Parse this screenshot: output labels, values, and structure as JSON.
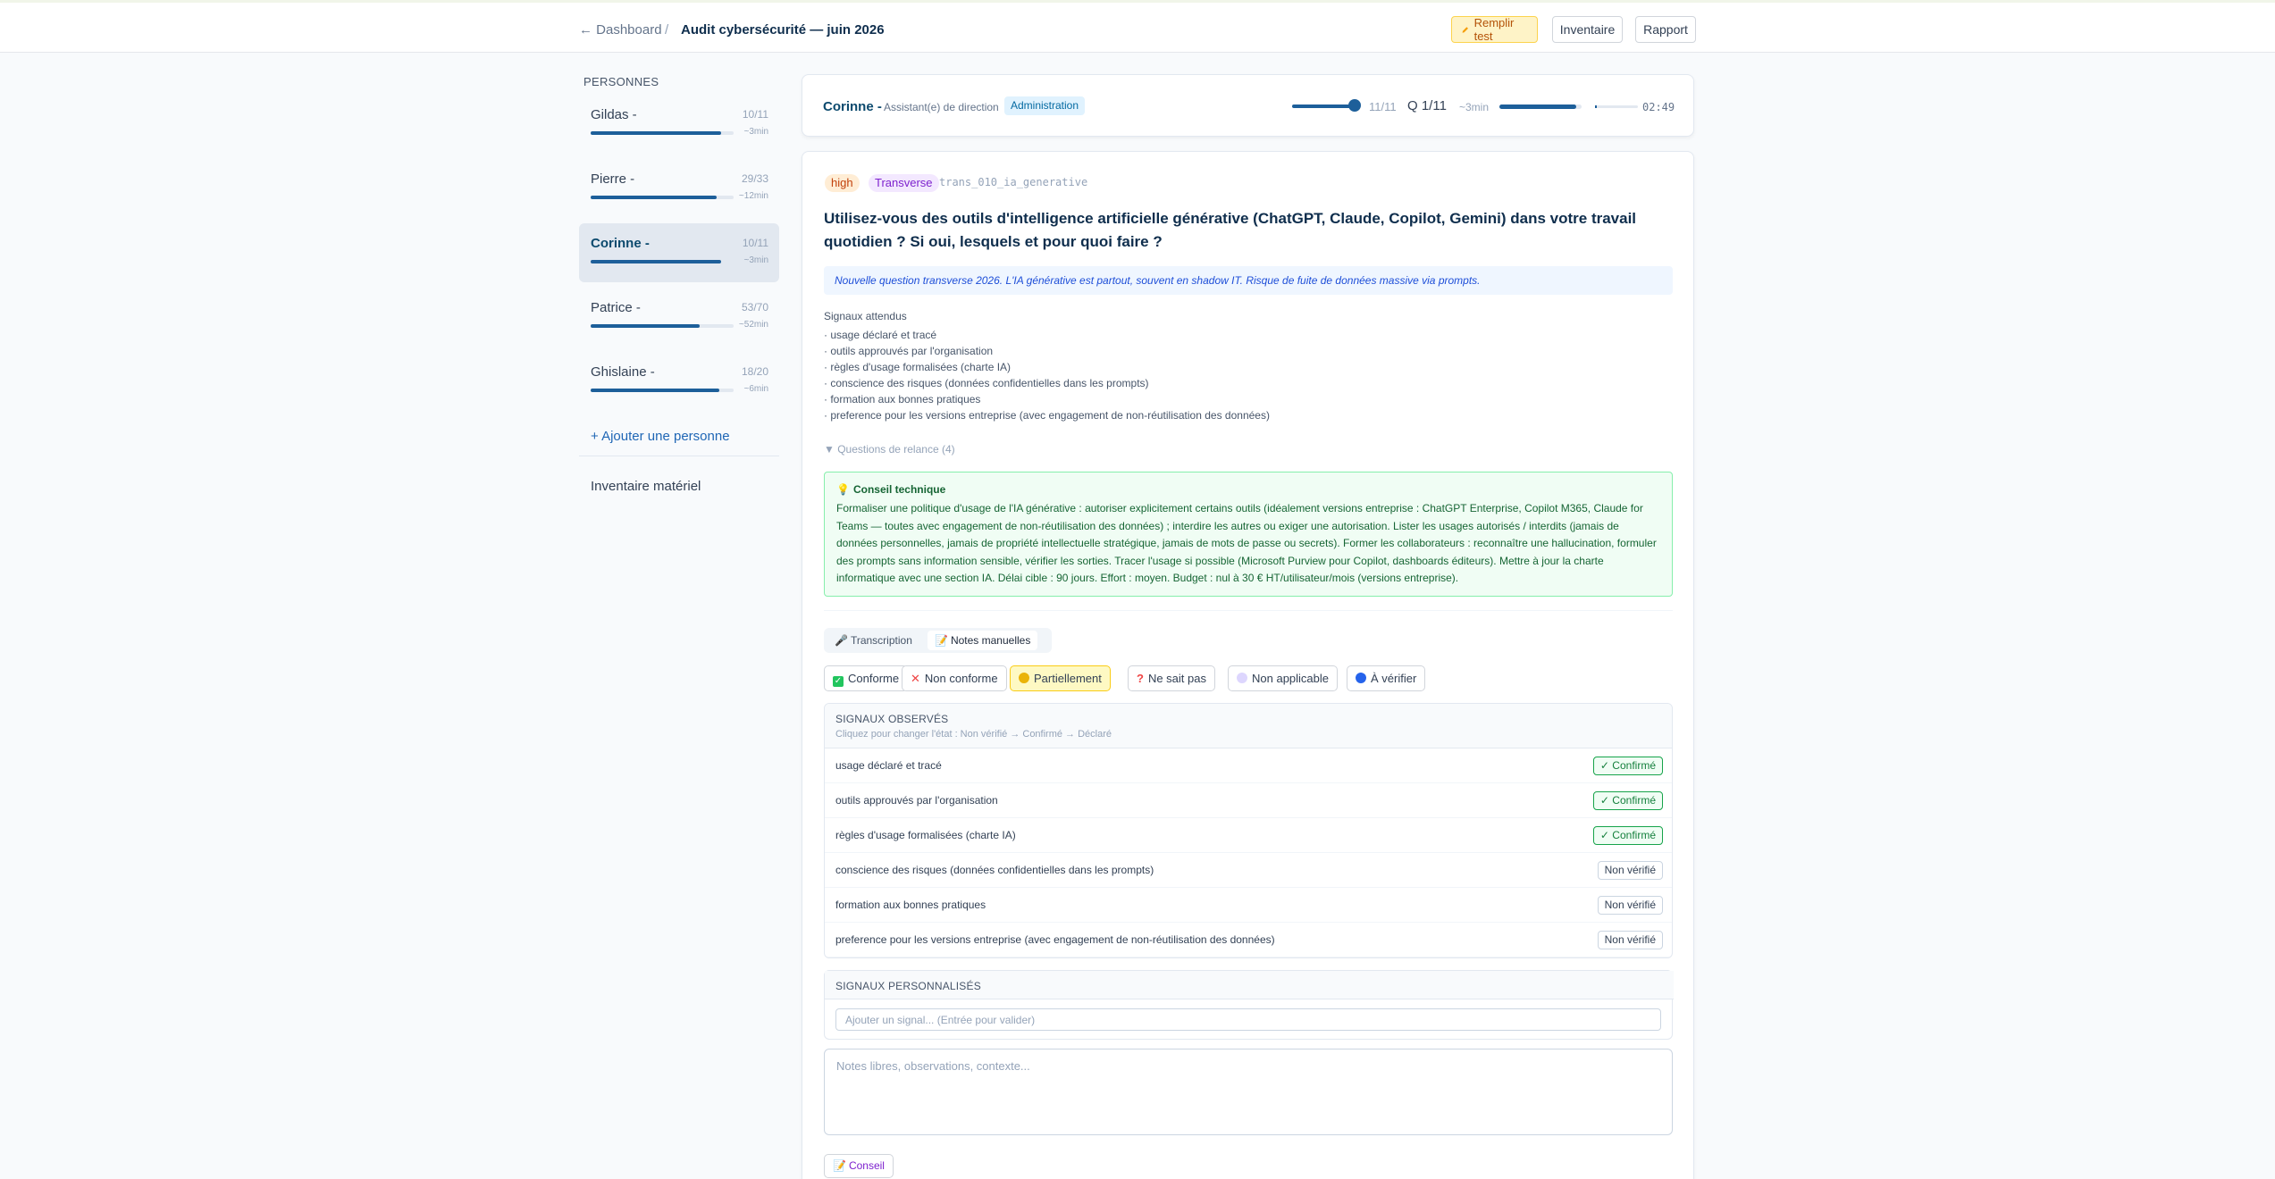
{
  "topbar": {
    "back_label": "← Dashboard",
    "separator": "/",
    "title": "Audit cybersécurité — juin 2026",
    "fill_test_label": "Remplir test",
    "fill_test_icon": "pencil-icon",
    "inventory_label": "Inventaire",
    "report_label": "Rapport"
  },
  "sidebar": {
    "heading": "PERSONNES",
    "people": [
      {
        "name": "Gildas -",
        "count": "10/11",
        "time": "~3min",
        "progress": 0.91,
        "active": false
      },
      {
        "name": "Pierre -",
        "count": "29/33",
        "time": "~12min",
        "progress": 0.88,
        "active": false
      },
      {
        "name": "Corinne -",
        "count": "10/11",
        "time": "~3min",
        "progress": 0.91,
        "active": true
      },
      {
        "name": "Patrice -",
        "count": "53/70",
        "time": "~52min",
        "progress": 0.76,
        "active": false
      },
      {
        "name": "Ghislaine -",
        "count": "18/20",
        "time": "~6min",
        "progress": 0.9,
        "active": false
      }
    ],
    "add_person": "+ Ajouter une personne",
    "inventory_link": "Inventaire matériel"
  },
  "header": {
    "name": "Corinne -",
    "role": "Assistant(e) de direction",
    "department": "Administration",
    "progress": "11/11",
    "question": "Q 1/11",
    "time_estimate": "~3min",
    "timer": "02:49",
    "slider_level": 1.0,
    "progress_bar": 0.93
  },
  "question": {
    "priority": "high",
    "category": "Transverse",
    "id": "trans_010_ia_generative",
    "text": "Utilisez-vous des outils d'intelligence artificielle générative (ChatGPT, Claude, Copilot, Gemini) dans votre travail quotidien ? Si oui, lesquels et pour quoi faire ?",
    "note": "Nouvelle question transverse 2026. L'IA générative est partout, souvent en shadow IT. Risque de fuite de données massive via prompts.",
    "signals_title": "Signaux attendus",
    "signals": [
      "· usage déclaré et tracé",
      "· outils approuvés par l'organisation",
      "· règles d'usage formalisées (charte IA)",
      "· conscience des risques (données confidentielles dans les prompts)",
      "· formation aux bonnes pratiques",
      "· preference pour les versions entreprise (avec engagement de non-réutilisation des données)"
    ],
    "followups": "▼ Questions de relance (4)",
    "advice_title": "Conseil technique",
    "advice_icon": "lightbulb-icon",
    "advice_text": "Formaliser une politique d'usage de l'IA générative : autoriser explicitement certains outils (idéalement versions entreprise : ChatGPT Enterprise, Copilot M365, Claude for Teams — toutes avec engagement de non-réutilisation des données) ; interdire les autres ou exiger une autorisation. Lister les usages autorisés / interdits (jamais de données personnelles, jamais de propriété intellectuelle stratégique, jamais de mots de passe ou secrets). Former les collaborateurs : reconnaître une hallucination, formuler des prompts sans information sensible, vérifier les sorties. Tracer l'usage si possible (Microsoft Purview pour Copilot, dashboards éditeurs). Mettre à jour la charte informatique avec une section IA. Délai cible : 90 jours. Effort : moyen. Budget : nul à 30 € HT/utilisateur/mois (versions entreprise)."
  },
  "tabs": [
    {
      "label": "Transcription",
      "icon": "microphone-icon"
    },
    {
      "label": "Notes manuelles",
      "icon": "notepad-icon"
    }
  ],
  "statuses": [
    {
      "label": "Conforme",
      "icon": "check-box-icon",
      "color": "#22c55e"
    },
    {
      "label": "Non conforme",
      "icon": "cross-icon",
      "color": "#ef4444"
    },
    {
      "label": "Partiellement",
      "icon": "partial-circle-icon",
      "color": "#eab308"
    },
    {
      "label": "Ne sait pas",
      "icon": "question-mark-icon",
      "color": "#ef4444"
    },
    {
      "label": "Non applicable",
      "icon": "moon-icon",
      "color": "#a78bfa"
    },
    {
      "label": "À vérifier",
      "icon": "blue-circle-icon",
      "color": "#2563eb"
    }
  ],
  "observed": {
    "title": "SIGNAUX OBSERVÉS",
    "subtitle": "Cliquez pour changer l'état : Non vérifié → Confirmé → Déclaré",
    "rows": [
      {
        "label": "usage déclaré et tracé",
        "state": "✓ Confirmé",
        "confirmed": true
      },
      {
        "label": "outils approuvés par l'organisation",
        "state": "✓ Confirmé",
        "confirmed": true
      },
      {
        "label": "règles d'usage formalisées (charte IA)",
        "state": "✓ Confirmé",
        "confirmed": true
      },
      {
        "label": "conscience des risques (données confidentielles dans les prompts)",
        "state": "Non vérifié",
        "confirmed": false
      },
      {
        "label": "formation aux bonnes pratiques",
        "state": "Non vérifié",
        "confirmed": false
      },
      {
        "label": "preference pour les versions entreprise (avec engagement de non-réutilisation des données)",
        "state": "Non vérifié",
        "confirmed": false
      }
    ]
  },
  "custom": {
    "title": "SIGNAUX PERSONNALISÉS",
    "placeholder": "Ajouter un signal... (Entrée pour valider)"
  },
  "notes": {
    "placeholder": "Notes libres, observations, contexte..."
  },
  "advice_button": {
    "label": "Conseil",
    "icon": "notepad-icon"
  }
}
